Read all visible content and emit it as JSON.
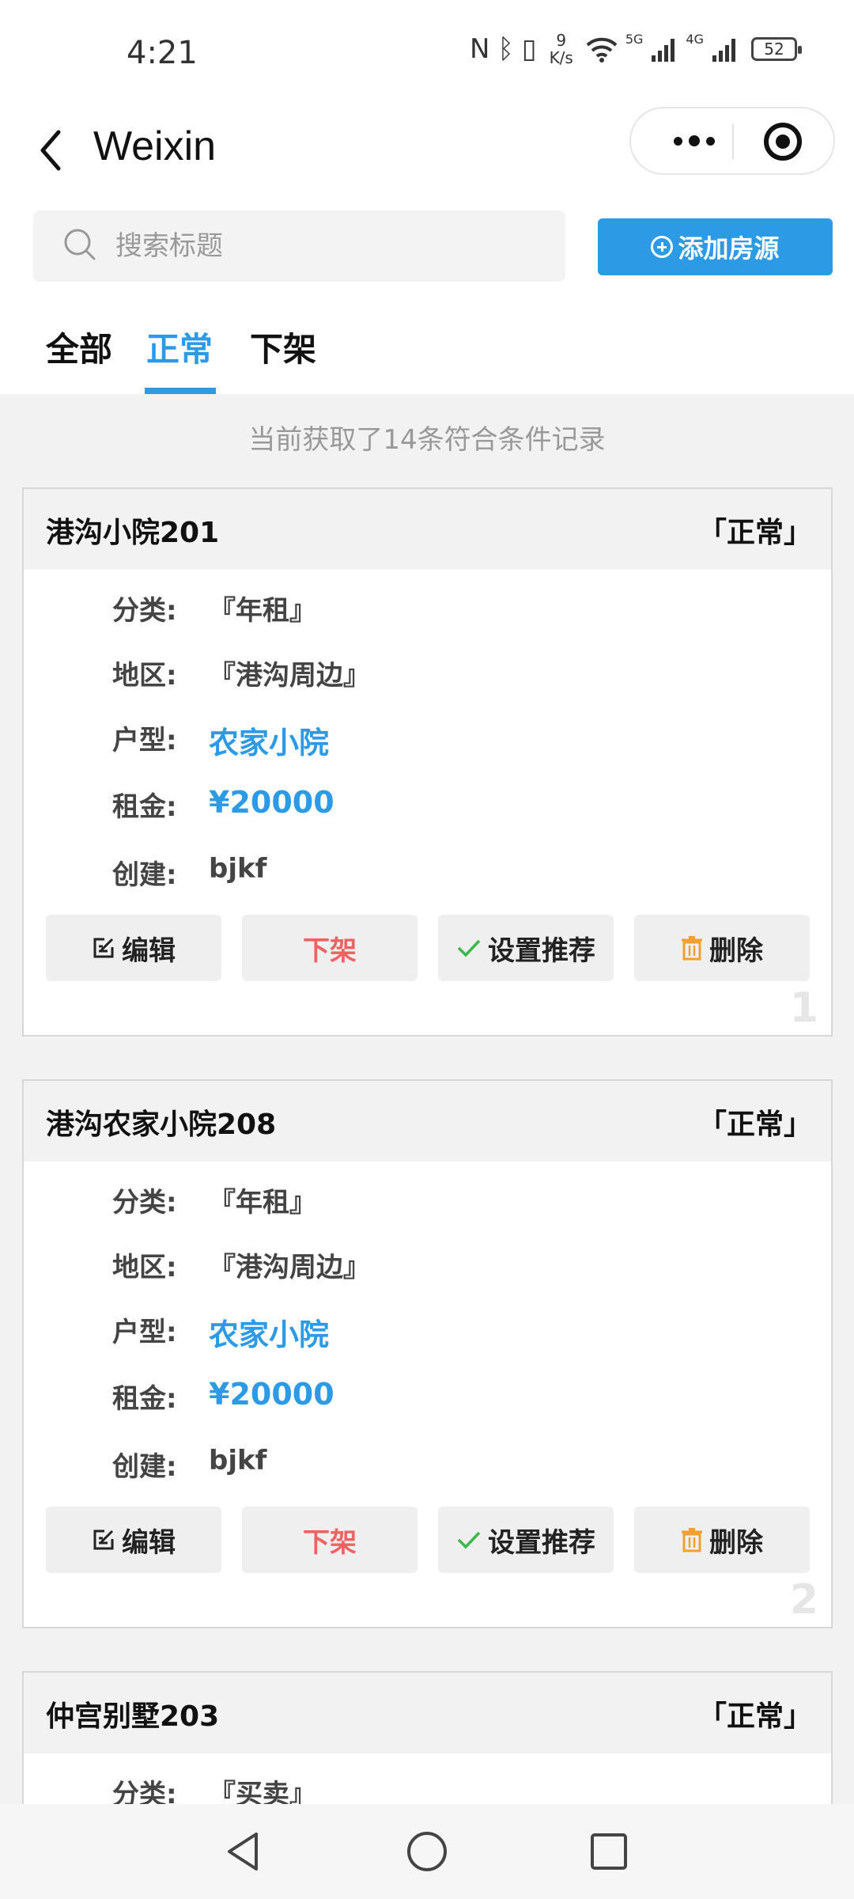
{
  "status_bar": {
    "time": "4:21",
    "net_speed_value": "9",
    "net_speed_unit": "K/s",
    "signal_5g": "5G",
    "signal_4g": "4G",
    "battery": "52"
  },
  "nav": {
    "title": "Weixin"
  },
  "search": {
    "placeholder": "搜索标题"
  },
  "add_button_label": "添加房源",
  "tabs": [
    "全部",
    "正常",
    "下架"
  ],
  "active_tab": 1,
  "count_text": "当前获取了14条符合条件记录",
  "colors": {
    "accent": "#2d9ae6",
    "danger": "#f06262",
    "delete_icon": "#f0a030",
    "check_icon": "#3cb84a"
  },
  "cards": [
    {
      "name": "港沟小院201",
      "status": "「正常」",
      "category_label": "分类:",
      "category": "『年租』",
      "region_label": "地区:",
      "region": "『港沟周边』",
      "type_label": "户型:",
      "type": "农家小院",
      "rent_label": "租金:",
      "rent": "¥20000",
      "creator_label": "创建:",
      "creator": "bjkf",
      "edit": "编辑",
      "offline": "下架",
      "recommend": "设置推荐",
      "delete": "删除",
      "index": "1"
    },
    {
      "name": "港沟农家小院208",
      "status": "「正常」",
      "category_label": "分类:",
      "category": "『年租』",
      "region_label": "地区:",
      "region": "『港沟周边』",
      "type_label": "户型:",
      "type": "农家小院",
      "rent_label": "租金:",
      "rent": "¥20000",
      "creator_label": "创建:",
      "creator": "bjkf",
      "edit": "编辑",
      "offline": "下架",
      "recommend": "设置推荐",
      "delete": "删除",
      "index": "2"
    },
    {
      "name": "仲宫别墅203",
      "status": "「正常」",
      "category_label": "分类:",
      "category": "『买卖』"
    }
  ]
}
